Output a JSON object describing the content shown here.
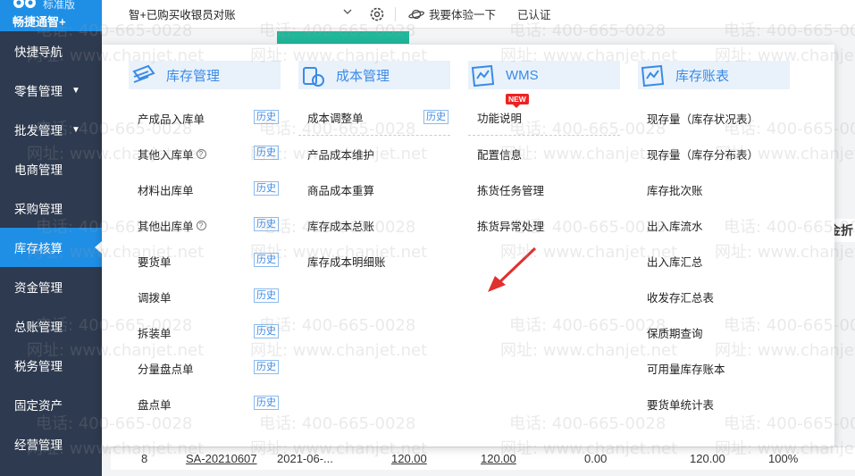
{
  "sidebar": {
    "brand": {
      "edition": "标准版",
      "product": "畅捷通智+"
    },
    "items": [
      {
        "label": "快捷导航",
        "caret": false,
        "active": false
      },
      {
        "label": "零售管理",
        "caret": true,
        "active": false
      },
      {
        "label": "批发管理",
        "caret": true,
        "active": false
      },
      {
        "label": "电商管理",
        "caret": false,
        "active": false
      },
      {
        "label": "采购管理",
        "caret": false,
        "active": false
      },
      {
        "label": "库存核算",
        "caret": false,
        "active": true
      },
      {
        "label": "资金管理",
        "caret": false,
        "active": false
      },
      {
        "label": "总账管理",
        "caret": false,
        "active": false
      },
      {
        "label": "税务管理",
        "caret": false,
        "active": false
      },
      {
        "label": "固定资产",
        "caret": false,
        "active": false
      },
      {
        "label": "经营管理",
        "caret": false,
        "active": false
      }
    ]
  },
  "topbar": {
    "org": "智+已购买收银员对账",
    "try_label": "我要体验一下",
    "verified_label": "已认证"
  },
  "menu": {
    "history_label": "历史",
    "new_label": "NEW",
    "columns": [
      {
        "title": "库存管理",
        "items": [
          {
            "label": "产成品入库单",
            "history": true,
            "help": false
          },
          {
            "label": "其他入库单",
            "history": true,
            "help": true
          },
          {
            "label": "材料出库单",
            "history": true,
            "help": false
          },
          {
            "label": "其他出库单",
            "history": true,
            "help": true
          },
          {
            "label": "要货单",
            "history": true,
            "help": false
          },
          {
            "label": "调拨单",
            "history": true,
            "help": false
          },
          {
            "label": "拆装单",
            "history": true,
            "help": false
          },
          {
            "label": "分量盘点单",
            "history": true,
            "help": false
          },
          {
            "label": "盘点单",
            "history": true,
            "help": false
          }
        ]
      },
      {
        "title": "成本管理",
        "items": [
          {
            "label": "成本调整单",
            "history": true
          },
          {
            "label": "产品成本维护",
            "history": false
          },
          {
            "label": "商品成本重算",
            "history": false
          },
          {
            "label": "库存成本总账",
            "history": false
          },
          {
            "label": "库存成本明细账",
            "history": false
          }
        ]
      },
      {
        "title": "WMS",
        "items": [
          {
            "label": "功能说明",
            "new": true
          },
          {
            "label": "配置信息"
          },
          {
            "label": "拣货任务管理"
          },
          {
            "label": "拣货异常处理"
          }
        ]
      },
      {
        "title": "库存账表",
        "items": [
          {
            "label": "现存量（库存状况表）"
          },
          {
            "label": "现存量（库存分布表）"
          },
          {
            "label": "库存批次账"
          },
          {
            "label": "出入库流水"
          },
          {
            "label": "出入库汇总"
          },
          {
            "label": "收发存汇总表"
          },
          {
            "label": "保质期查询"
          },
          {
            "label": "可用量库存账本"
          },
          {
            "label": "要货单统计表"
          }
        ]
      }
    ]
  },
  "background_row": {
    "index": "8",
    "code": "SA-20210607",
    "date": "2021-06-...",
    "amount1": "120.00",
    "amount2": "120.00",
    "amount3": "0.00",
    "amount4": "120.00",
    "percent": "100%"
  },
  "background_edge_text": "金折",
  "watermark": {
    "phone": "电话: 400-665-0028",
    "site": "网址: www.chanjet.net"
  },
  "colors": {
    "sidebar": "#2e3a4f",
    "accent": "#1f8fe6",
    "menu_header_bg": "#e9f2fb",
    "menu_header_text": "#3a8ae6",
    "new_badge": "#e22222",
    "arrow": "#e03030"
  }
}
